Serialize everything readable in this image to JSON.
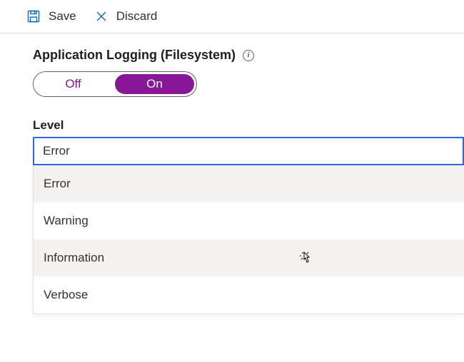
{
  "toolbar": {
    "save_label": "Save",
    "discard_label": "Discard"
  },
  "section": {
    "title": "Application Logging (Filesystem)",
    "toggle": {
      "off_label": "Off",
      "on_label": "On",
      "value": "On"
    }
  },
  "level": {
    "label": "Level",
    "selected": "Error",
    "options": [
      "Error",
      "Warning",
      "Information",
      "Verbose"
    ],
    "hover_index": 2
  }
}
